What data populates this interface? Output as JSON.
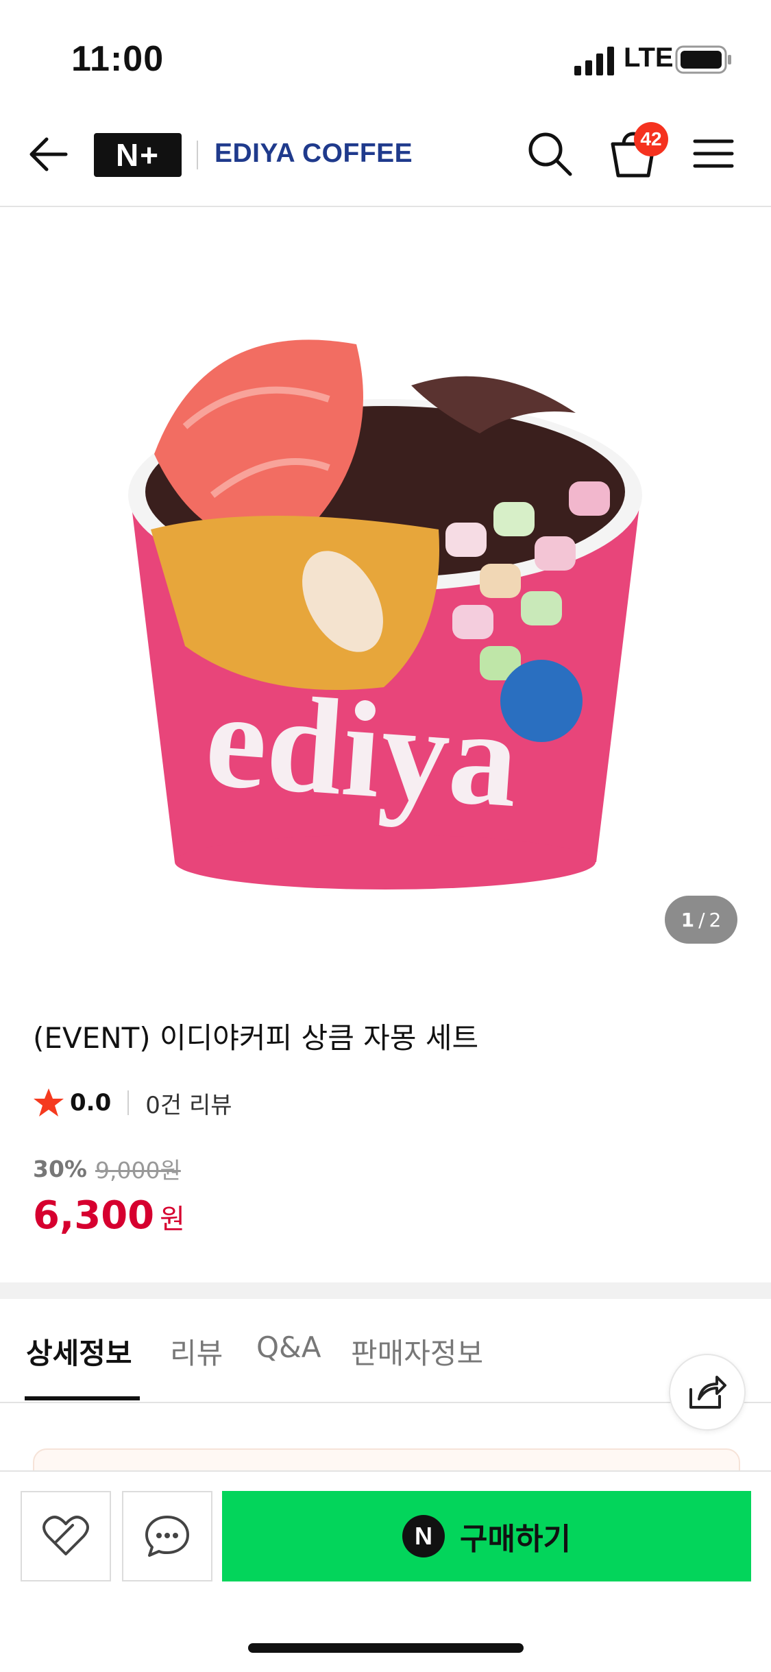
{
  "status_bar": {
    "time": "11:00",
    "network": "LTE"
  },
  "header": {
    "logo_text": "N+",
    "brand": "EDIYA COFFEE",
    "cart_count": "42"
  },
  "gallery": {
    "current": "1",
    "separator": "/",
    "total": "2"
  },
  "product": {
    "title": "(EVENT) 이디야커피 상큼 자몽 세트",
    "rating": "0.0",
    "review_count": "0건 리뷰",
    "discount": "30%",
    "original_price": "9,000원",
    "price": "6,300",
    "price_unit": "원"
  },
  "tabs": [
    {
      "label": "상세정보",
      "active": true
    },
    {
      "label": "리뷰"
    },
    {
      "label": "Q&A"
    },
    {
      "label": "판매자정보"
    }
  ],
  "bottom_bar": {
    "buy_label": "구매하기",
    "pay_badge": "N"
  },
  "colors": {
    "brand": "#1f3a8c",
    "price": "#d6002f",
    "buy": "#03d55b",
    "badge": "#f5321f",
    "star": "#f53a1f"
  }
}
